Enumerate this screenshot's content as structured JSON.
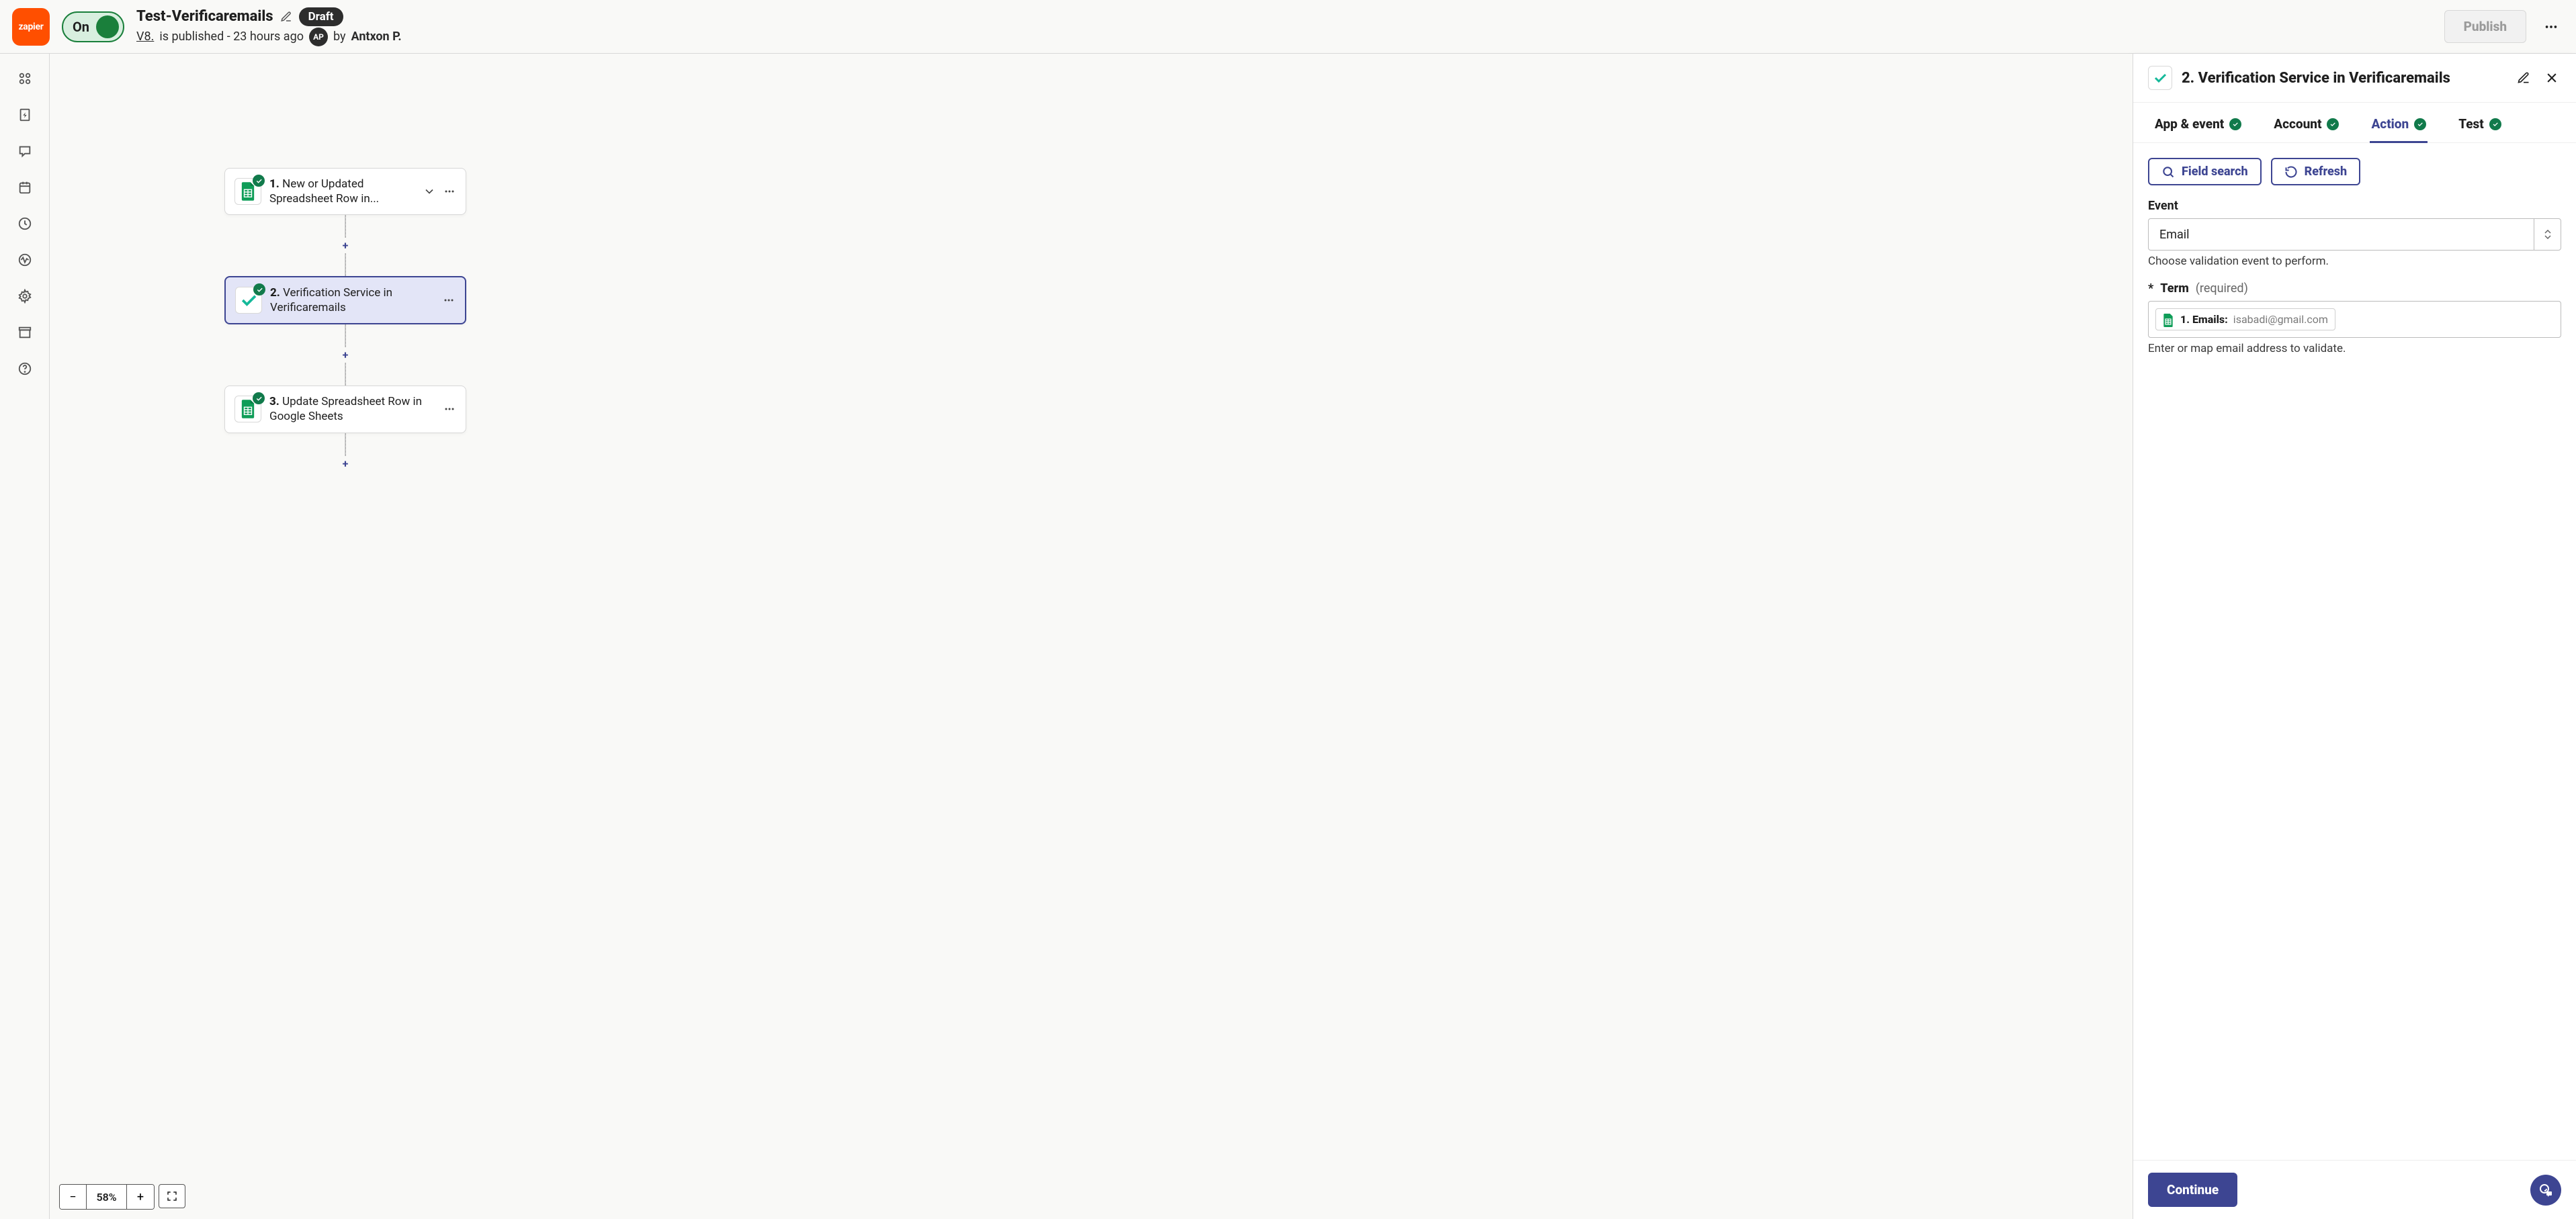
{
  "header": {
    "logo_text": "zapier",
    "toggle_label": "On",
    "title": "Test-Verificaremails",
    "draft_badge": "Draft",
    "version_link": "V8.",
    "status_text": "is published - 23 hours ago",
    "avatar_initials": "AP",
    "by_text": "by",
    "author": "Antxon P.",
    "publish_label": "Publish"
  },
  "rail_icons": [
    "apps",
    "zap",
    "chat",
    "calendar",
    "clock",
    "activity",
    "settings",
    "archive",
    "help"
  ],
  "flow": {
    "steps": [
      {
        "num": "1.",
        "text": "New or Updated Spreadsheet Row in...",
        "app": "sheets",
        "selected": false,
        "has_chevron": true
      },
      {
        "num": "2.",
        "text": "Verification Service in Verificaremails",
        "app": "verif",
        "selected": true,
        "has_chevron": false
      },
      {
        "num": "3.",
        "text": "Update Spreadsheet Row in Google Sheets",
        "app": "sheets",
        "selected": false,
        "has_chevron": false
      }
    ]
  },
  "zoom": {
    "value": "58%"
  },
  "panel": {
    "title": "2. Verification Service in Verificaremails",
    "tabs": [
      {
        "label": "App & event",
        "active": false,
        "check": true
      },
      {
        "label": "Account",
        "active": false,
        "check": true
      },
      {
        "label": "Action",
        "active": true,
        "check": true
      },
      {
        "label": "Test",
        "active": false,
        "check": true
      }
    ],
    "field_search_label": "Field search",
    "refresh_label": "Refresh",
    "event": {
      "label": "Event",
      "value": "Email",
      "hint": "Choose validation event to perform."
    },
    "term": {
      "star": "*",
      "label": "Term",
      "required": "(required)",
      "pill_key": "1. Emails:",
      "pill_val": "isabadi@gmail.com",
      "hint": "Enter or map email address to validate."
    },
    "continue_label": "Continue"
  }
}
